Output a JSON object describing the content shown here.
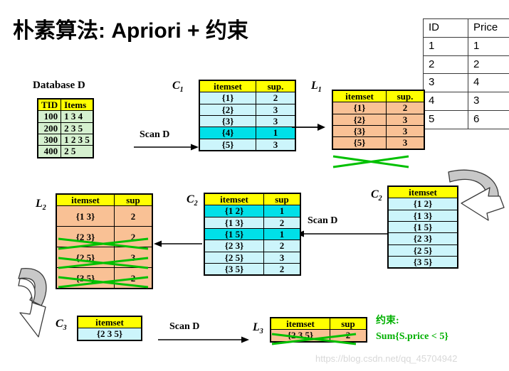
{
  "slide": {
    "title": "朴素算法: Apriori + 约束",
    "watermark": "https://blog.csdn.net/qq_45704942"
  },
  "price_table": {
    "name": "id-price-table",
    "headers": [
      "ID",
      "Price"
    ],
    "rows": [
      [
        "1",
        "1"
      ],
      [
        "2",
        "2"
      ],
      [
        "3",
        "4"
      ],
      [
        "4",
        "3"
      ],
      [
        "5",
        "6"
      ]
    ]
  },
  "database": {
    "caption": "Database D",
    "headers": [
      "TID",
      "Items"
    ],
    "rows": [
      [
        "100",
        "1 3 4"
      ],
      [
        "200",
        "2 3 5"
      ],
      [
        "300",
        "1 2 3 5"
      ],
      [
        "400",
        "2 5"
      ]
    ]
  },
  "c1": {
    "label": "C",
    "sub": "1",
    "headers": [
      "itemset",
      "sup."
    ],
    "rows": [
      {
        "itemset": "{1}",
        "sup": "2",
        "highlight": false
      },
      {
        "itemset": "{2}",
        "sup": "3",
        "highlight": false
      },
      {
        "itemset": "{3}",
        "sup": "3",
        "highlight": false
      },
      {
        "itemset": "{4}",
        "sup": "1",
        "highlight": true
      },
      {
        "itemset": "{5}",
        "sup": "3",
        "highlight": false
      }
    ]
  },
  "l1": {
    "label": "L",
    "sub": "1",
    "headers": [
      "itemset",
      "sup."
    ],
    "rows": [
      {
        "itemset": "{1}",
        "sup": "2",
        "struck": false
      },
      {
        "itemset": "{2}",
        "sup": "3",
        "struck": false
      },
      {
        "itemset": "{3}",
        "sup": "3",
        "struck": false
      },
      {
        "itemset": "{5}",
        "sup": "3",
        "struck": true
      }
    ]
  },
  "c2_right": {
    "label": "C",
    "sub": "2",
    "headers": [
      "itemset"
    ],
    "rows": [
      "{1 2}",
      "{1 3}",
      "{1 5}",
      "{2 3}",
      "{2 5}",
      "{3 5}"
    ]
  },
  "c2_mid": {
    "label": "C",
    "sub": "2",
    "headers": [
      "itemset",
      "sup"
    ],
    "rows": [
      {
        "itemset": "{1 2}",
        "sup": "1",
        "highlight": true
      },
      {
        "itemset": "{1 3}",
        "sup": "2",
        "highlight": false
      },
      {
        "itemset": "{1 5}",
        "sup": "1",
        "highlight": true
      },
      {
        "itemset": "{2 3}",
        "sup": "2",
        "highlight": false
      },
      {
        "itemset": "{2 5}",
        "sup": "3",
        "highlight": false
      },
      {
        "itemset": "{3 5}",
        "sup": "2",
        "highlight": false
      }
    ]
  },
  "l2": {
    "label": "L",
    "sub": "2",
    "headers": [
      "itemset",
      "sup"
    ],
    "rows": [
      {
        "itemset": "{1 3}",
        "sup": "2",
        "struck": false
      },
      {
        "itemset": "{2 3}",
        "sup": "2",
        "struck": true
      },
      {
        "itemset": "{2 5}",
        "sup": "3",
        "struck": true
      },
      {
        "itemset": "{3 5}",
        "sup": "2",
        "struck": true
      }
    ]
  },
  "c3": {
    "label": "C",
    "sub": "3",
    "headers": [
      "itemset"
    ],
    "rows": [
      "{2 3 5}"
    ]
  },
  "l3": {
    "label": "L",
    "sub": "3",
    "headers": [
      "itemset",
      "sup"
    ],
    "rows": [
      {
        "itemset": "{2 3 5}",
        "sup": "2",
        "struck": true
      }
    ]
  },
  "arrows": {
    "scan_d_1": "Scan D",
    "scan_d_2": "Scan D",
    "scan_d_3": "Scan D"
  },
  "constraint": {
    "line1": "约束:",
    "line2": "Sum{S.price < 5}"
  },
  "colors": {
    "header_yellow": "#ffff00",
    "cyan_body": "#ccf5fb",
    "cyan_highlight": "#00e0e8",
    "orange_body": "#f9c195",
    "green_body": "#d5f0cf",
    "strike_green": "#00c000",
    "constraint_green": "#00b000"
  }
}
